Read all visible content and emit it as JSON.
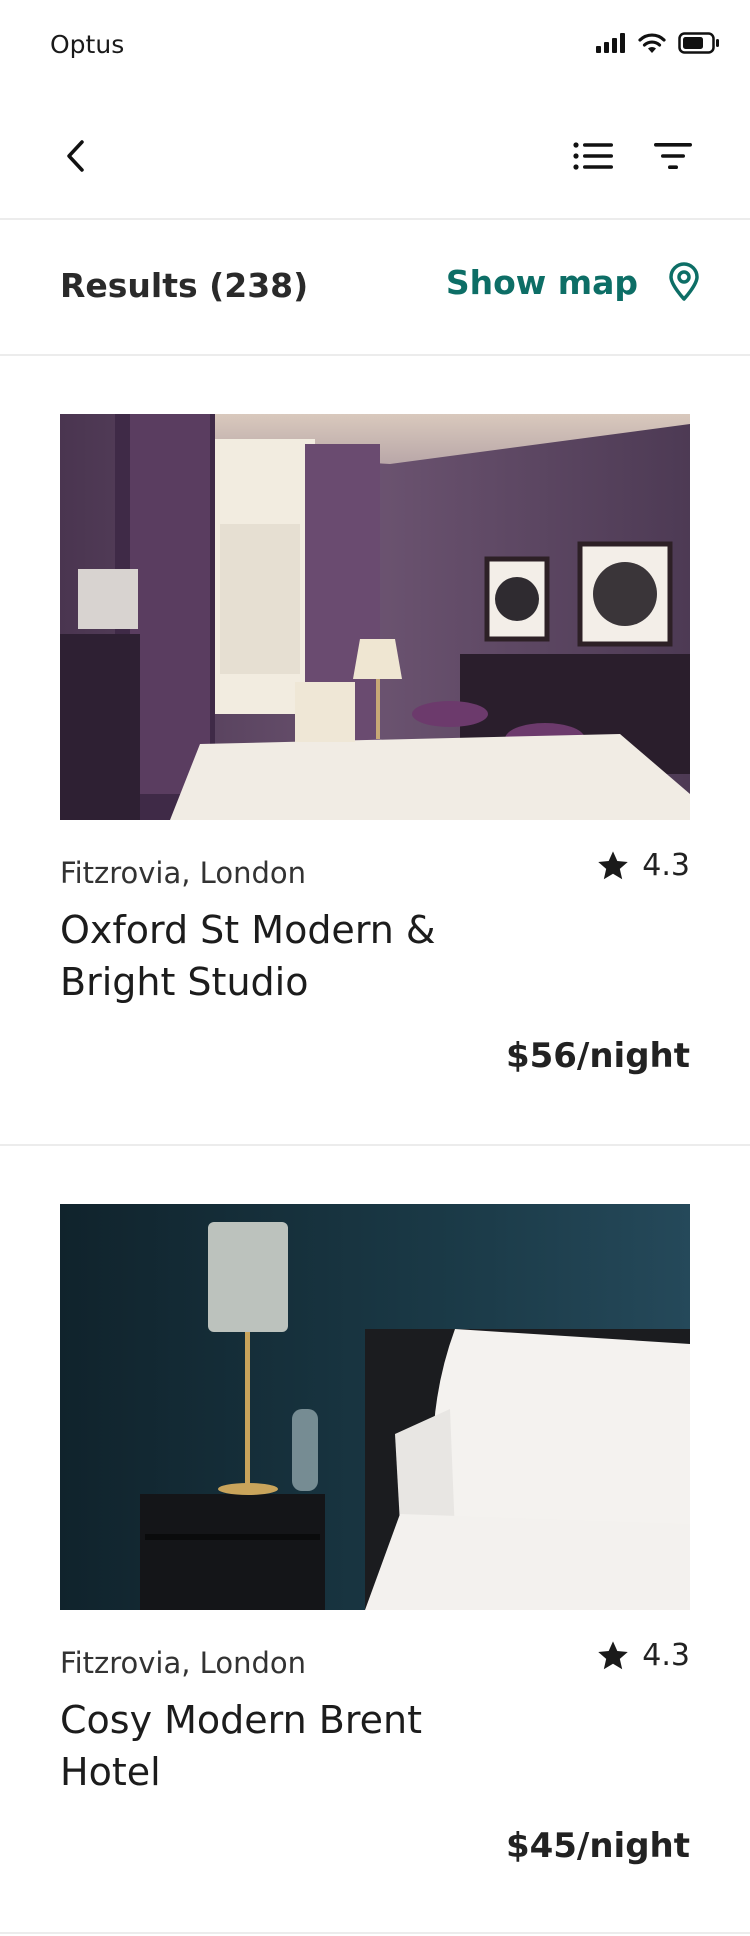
{
  "status_bar": {
    "carrier": "Optus",
    "icons": [
      "cellular-signal-icon",
      "wifi-icon",
      "battery-icon"
    ]
  },
  "nav": {
    "back_icon": "chevron-left-icon",
    "list_icon": "list-view-icon",
    "filter_icon": "filter-icon"
  },
  "results": {
    "title": "Results (238)",
    "show_map_label": "Show map",
    "map_icon": "map-pin-icon",
    "accent_color": "#0d6e66"
  },
  "listings": [
    {
      "location": "Fitzrovia, London",
      "rating": "4.3",
      "name": "Oxford St Modern & Bright Studio",
      "price": "$56/night",
      "photo": "hotel-room-purple-photo"
    },
    {
      "location": "Fitzrovia, London",
      "rating": "4.3",
      "name": "Cosy Modern Brent Hotel",
      "price": "$45/night",
      "photo": "bedroom-teal-lamp-photo"
    }
  ]
}
